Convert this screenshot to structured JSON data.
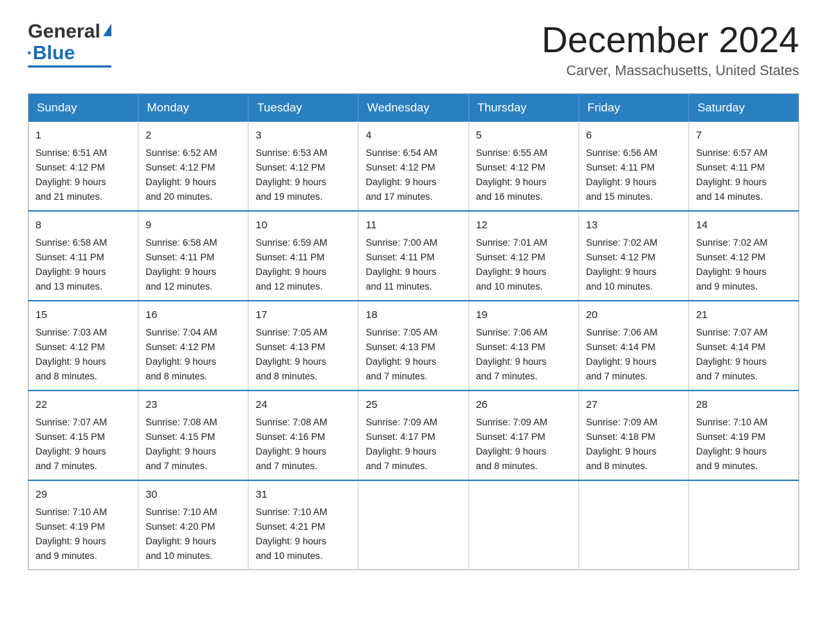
{
  "header": {
    "logo_text_general": "General",
    "logo_text_blue": "Blue",
    "month_title": "December 2024",
    "location": "Carver, Massachusetts, United States"
  },
  "weekdays": [
    "Sunday",
    "Monday",
    "Tuesday",
    "Wednesday",
    "Thursday",
    "Friday",
    "Saturday"
  ],
  "weeks": [
    [
      {
        "day": "1",
        "sunrise": "6:51 AM",
        "sunset": "4:12 PM",
        "daylight": "9 hours and 21 minutes."
      },
      {
        "day": "2",
        "sunrise": "6:52 AM",
        "sunset": "4:12 PM",
        "daylight": "9 hours and 20 minutes."
      },
      {
        "day": "3",
        "sunrise": "6:53 AM",
        "sunset": "4:12 PM",
        "daylight": "9 hours and 19 minutes."
      },
      {
        "day": "4",
        "sunrise": "6:54 AM",
        "sunset": "4:12 PM",
        "daylight": "9 hours and 17 minutes."
      },
      {
        "day": "5",
        "sunrise": "6:55 AM",
        "sunset": "4:12 PM",
        "daylight": "9 hours and 16 minutes."
      },
      {
        "day": "6",
        "sunrise": "6:56 AM",
        "sunset": "4:11 PM",
        "daylight": "9 hours and 15 minutes."
      },
      {
        "day": "7",
        "sunrise": "6:57 AM",
        "sunset": "4:11 PM",
        "daylight": "9 hours and 14 minutes."
      }
    ],
    [
      {
        "day": "8",
        "sunrise": "6:58 AM",
        "sunset": "4:11 PM",
        "daylight": "9 hours and 13 minutes."
      },
      {
        "day": "9",
        "sunrise": "6:58 AM",
        "sunset": "4:11 PM",
        "daylight": "9 hours and 12 minutes."
      },
      {
        "day": "10",
        "sunrise": "6:59 AM",
        "sunset": "4:11 PM",
        "daylight": "9 hours and 12 minutes."
      },
      {
        "day": "11",
        "sunrise": "7:00 AM",
        "sunset": "4:11 PM",
        "daylight": "9 hours and 11 minutes."
      },
      {
        "day": "12",
        "sunrise": "7:01 AM",
        "sunset": "4:12 PM",
        "daylight": "9 hours and 10 minutes."
      },
      {
        "day": "13",
        "sunrise": "7:02 AM",
        "sunset": "4:12 PM",
        "daylight": "9 hours and 10 minutes."
      },
      {
        "day": "14",
        "sunrise": "7:02 AM",
        "sunset": "4:12 PM",
        "daylight": "9 hours and 9 minutes."
      }
    ],
    [
      {
        "day": "15",
        "sunrise": "7:03 AM",
        "sunset": "4:12 PM",
        "daylight": "9 hours and 8 minutes."
      },
      {
        "day": "16",
        "sunrise": "7:04 AM",
        "sunset": "4:12 PM",
        "daylight": "9 hours and 8 minutes."
      },
      {
        "day": "17",
        "sunrise": "7:05 AM",
        "sunset": "4:13 PM",
        "daylight": "9 hours and 8 minutes."
      },
      {
        "day": "18",
        "sunrise": "7:05 AM",
        "sunset": "4:13 PM",
        "daylight": "9 hours and 7 minutes."
      },
      {
        "day": "19",
        "sunrise": "7:06 AM",
        "sunset": "4:13 PM",
        "daylight": "9 hours and 7 minutes."
      },
      {
        "day": "20",
        "sunrise": "7:06 AM",
        "sunset": "4:14 PM",
        "daylight": "9 hours and 7 minutes."
      },
      {
        "day": "21",
        "sunrise": "7:07 AM",
        "sunset": "4:14 PM",
        "daylight": "9 hours and 7 minutes."
      }
    ],
    [
      {
        "day": "22",
        "sunrise": "7:07 AM",
        "sunset": "4:15 PM",
        "daylight": "9 hours and 7 minutes."
      },
      {
        "day": "23",
        "sunrise": "7:08 AM",
        "sunset": "4:15 PM",
        "daylight": "9 hours and 7 minutes."
      },
      {
        "day": "24",
        "sunrise": "7:08 AM",
        "sunset": "4:16 PM",
        "daylight": "9 hours and 7 minutes."
      },
      {
        "day": "25",
        "sunrise": "7:09 AM",
        "sunset": "4:17 PM",
        "daylight": "9 hours and 7 minutes."
      },
      {
        "day": "26",
        "sunrise": "7:09 AM",
        "sunset": "4:17 PM",
        "daylight": "9 hours and 8 minutes."
      },
      {
        "day": "27",
        "sunrise": "7:09 AM",
        "sunset": "4:18 PM",
        "daylight": "9 hours and 8 minutes."
      },
      {
        "day": "28",
        "sunrise": "7:10 AM",
        "sunset": "4:19 PM",
        "daylight": "9 hours and 9 minutes."
      }
    ],
    [
      {
        "day": "29",
        "sunrise": "7:10 AM",
        "sunset": "4:19 PM",
        "daylight": "9 hours and 9 minutes."
      },
      {
        "day": "30",
        "sunrise": "7:10 AM",
        "sunset": "4:20 PM",
        "daylight": "9 hours and 10 minutes."
      },
      {
        "day": "31",
        "sunrise": "7:10 AM",
        "sunset": "4:21 PM",
        "daylight": "9 hours and 10 minutes."
      },
      null,
      null,
      null,
      null
    ]
  ]
}
